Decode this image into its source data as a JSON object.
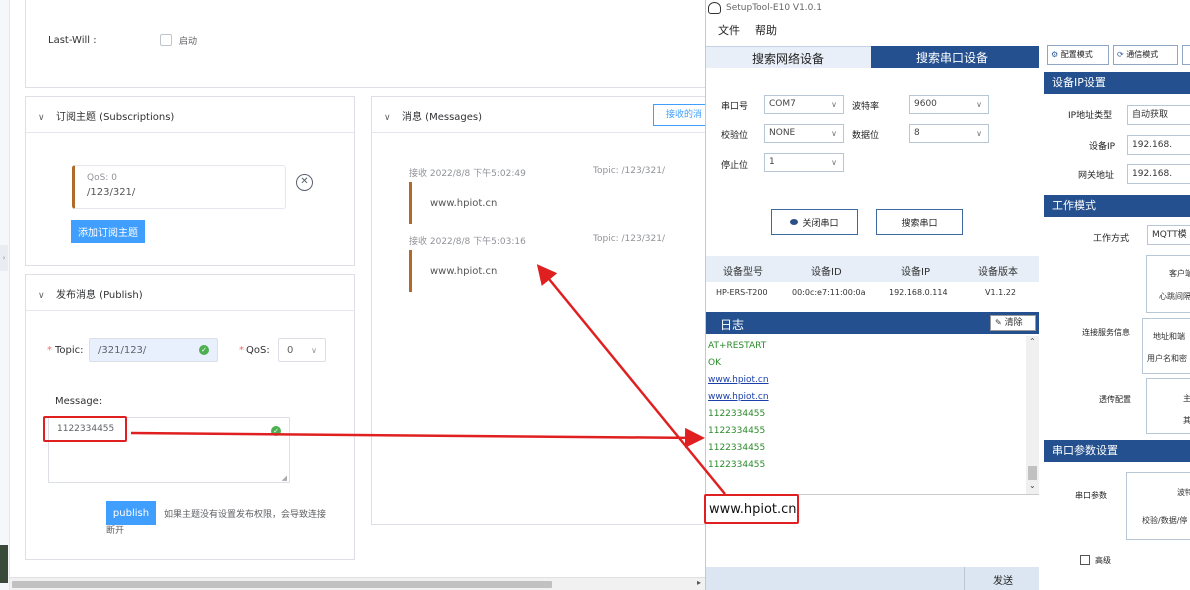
{
  "left": {
    "lastwill": {
      "label": "Last-Will :",
      "checkbox_label": "启动"
    },
    "subscriptions": {
      "title": "订阅主题 (Subscriptions)",
      "item": {
        "qos": "QoS: 0",
        "topic": "/123/321/"
      },
      "add_button": "添加订阅主题"
    },
    "publish": {
      "title": "发布消息 (Publish)",
      "topic_label": "Topic:",
      "topic_value": "/321/123/",
      "qos_label": "QoS:",
      "qos_value": "0",
      "message_label": "Message:",
      "message_value": "1122334455",
      "button": "publish",
      "note": "如果主题没有设置发布权限，会导致连接断开"
    },
    "messages": {
      "title": "消息 (Messages)",
      "button": "接收的消",
      "items": [
        {
          "meta": "接收  2022/8/8 下午5:02:49",
          "topic": "Topic: /123/321/",
          "body": "www.hpiot.cn"
        },
        {
          "meta": "接收  2022/8/8 下午5:03:16",
          "topic": "Topic: /123/321/",
          "body": "www.hpiot.cn"
        }
      ]
    }
  },
  "app": {
    "title": "SetupTool-E10 V1.0.1",
    "menu": [
      "文件",
      "帮助"
    ],
    "tabs": [
      "搜索网络设备",
      "搜索串口设备"
    ],
    "mode_buttons": [
      "配置模式",
      "通信模式"
    ],
    "serial": {
      "port_label": "串口号",
      "port_value": "COM7",
      "baud_label": "波特率",
      "baud_value": "9600",
      "parity_label": "校验位",
      "parity_value": "NONE",
      "data_label": "数据位",
      "data_value": "8",
      "stop_label": "停止位",
      "stop_value": "1",
      "close_button": "关闭串口",
      "search_button": "搜索串口"
    },
    "device_table": {
      "headers": [
        "设备型号",
        "设备ID",
        "设备IP",
        "设备版本"
      ],
      "row": [
        "HP-ERS-T200",
        "00:0c:e7:11:00:0a",
        "192.168.0.114",
        "V1.1.22"
      ]
    },
    "log": {
      "title": "日志",
      "clear": "清除",
      "lines": [
        {
          "text": "AT+RESTART",
          "link": false
        },
        {
          "text": "OK",
          "link": false
        },
        {
          "text": "www.hpiot.cn",
          "link": true
        },
        {
          "text": "www.hpiot.cn",
          "link": true
        },
        {
          "text": "1122334455",
          "link": false
        },
        {
          "text": "1122334455",
          "link": false
        },
        {
          "text": "1122334455",
          "link": false
        },
        {
          "text": "1122334455",
          "link": false
        }
      ]
    },
    "send_area": {
      "text": "www.hpiot.cn",
      "button": "发送"
    },
    "ip_settings": {
      "header": "设备IP设置",
      "ip_type_label": "IP地址类型",
      "ip_type_value": "自动获取",
      "ip_label": "设备IP",
      "ip_value": "192.168.",
      "gateway_label": "网关地址",
      "gateway_value": "192.168."
    },
    "work_mode": {
      "header": "工作模式",
      "mode_label": "工作方式",
      "mode_value": "MQTT模",
      "conn_label": "连接服务信息",
      "passthrough_label": "透传配置",
      "btn_client": "客户端",
      "btn_heartbeat": "心跳间隔",
      "btn_address": "地址和端",
      "btn_user": "用户名和密",
      "btn_main": "主",
      "btn_sub": "其"
    },
    "serial_params": {
      "header": "串口参数设置",
      "label": "串口参数",
      "btn_line1": "波特",
      "btn_line2": "校验/数据/停",
      "advanced": "高级"
    }
  },
  "colors": {
    "accent": "#409eff",
    "app_header": "#24508f",
    "annotation": "#e02020"
  }
}
